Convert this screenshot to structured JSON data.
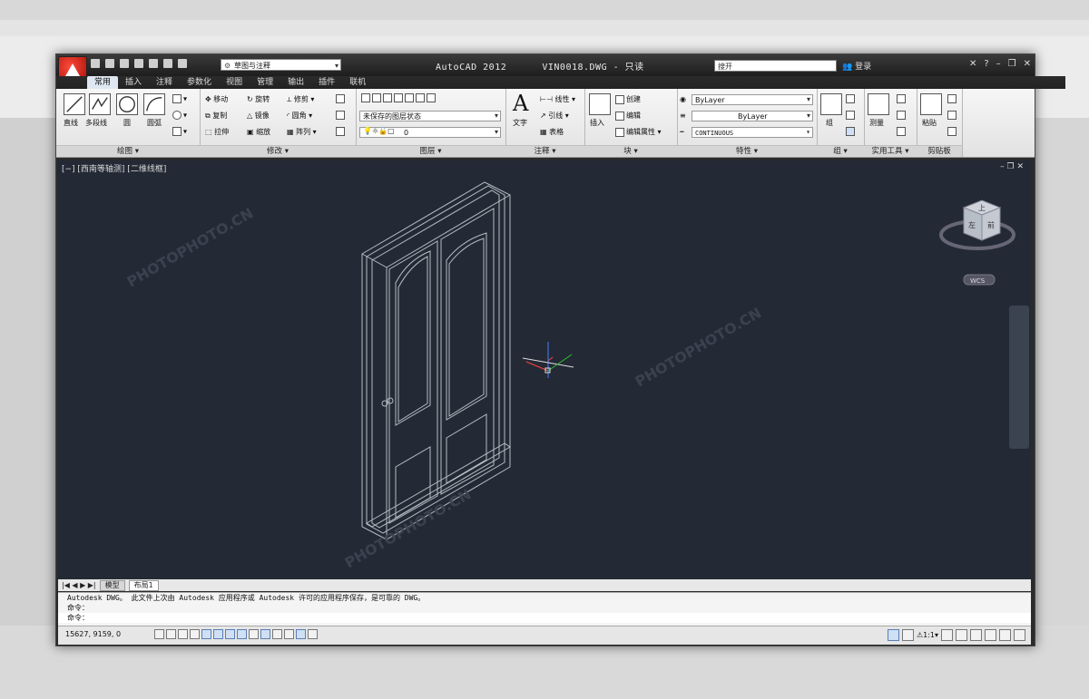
{
  "app_title": "AutoCAD 2012",
  "file_title": "VIN0018.DWG - 只读",
  "workspace": "草图与注释",
  "search_placeholder": "搜开",
  "login": "登录",
  "tabs": [
    "常用",
    "插入",
    "注释",
    "参数化",
    "视图",
    "管理",
    "输出",
    "插件",
    "联机"
  ],
  "draw_panel": {
    "title": "绘图",
    "line": "直线",
    "polyline": "多段线",
    "circle": "圆",
    "arc": "圆弧"
  },
  "modify_panel": {
    "title": "修改",
    "move": "移动",
    "rotate": "旋转",
    "trim": "修剪",
    "copy": "复制",
    "mirror": "镜像",
    "fillet": "圆角",
    "stretch": "拉伸",
    "scale": "缩放",
    "array": "阵列"
  },
  "layers_panel": {
    "title": "图层",
    "state": "未保存的图层状态",
    "current": "0"
  },
  "annotation_panel": {
    "title": "注释",
    "text": "文字",
    "linear": "线性",
    "leader": "引线",
    "table": "表格"
  },
  "block_panel": {
    "title": "块",
    "insert": "插入",
    "create": "创建",
    "edit": "编辑",
    "edit_attr": "编辑属性"
  },
  "properties_panel": {
    "title": "特性",
    "color": "ByLayer",
    "lineweight": "ByLayer",
    "linetype": "CONTINUOUS"
  },
  "group_panel": {
    "title": "组",
    "group": "组"
  },
  "utilities_panel": {
    "title": "实用工具",
    "measure": "测量"
  },
  "clipboard_panel": {
    "title": "剪贴板",
    "paste": "粘贴"
  },
  "viewport": {
    "label": "[−] [西南等轴测] [二维线框]",
    "wcs": "WCS",
    "cube_top": "上",
    "cube_left": "左",
    "cube_front": "前"
  },
  "watermarks": [
    "PHOTOPHOTO.CN",
    "PHOTOPHOTO.CN",
    "PHOTOPHOTO.CN"
  ],
  "layout_tabs": [
    "模型",
    "布局1"
  ],
  "command_lines": [
    "Autodesk DWG。  此文件上次由 Autodesk 应用程序或 Autodesk 许可的应用程序保存，是可靠的 DWG。",
    "命令：",
    "命令："
  ],
  "coords": "15627, 9159, 0",
  "anno_scale": "1:1"
}
